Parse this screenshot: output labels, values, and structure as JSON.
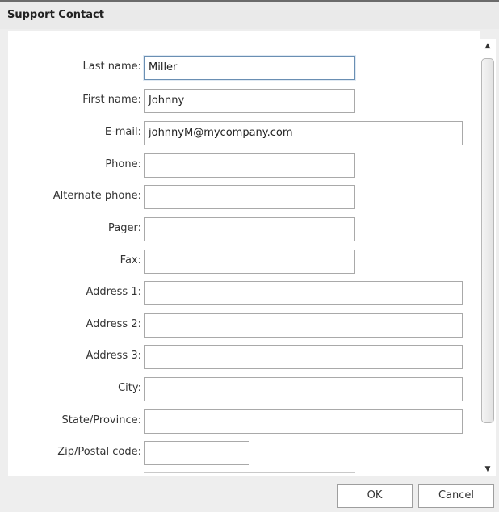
{
  "dialog": {
    "title": "Support Contact"
  },
  "form": {
    "fields": [
      {
        "label": "Last name:",
        "value": "Miller"
      },
      {
        "label": "First name:",
        "value": "Johnny"
      },
      {
        "label": "E-mail:",
        "value": "johnnyM@mycompany.com"
      },
      {
        "label": "Phone:",
        "value": ""
      },
      {
        "label": "Alternate phone:",
        "value": ""
      },
      {
        "label": "Pager:",
        "value": ""
      },
      {
        "label": "Fax:",
        "value": ""
      },
      {
        "label": "Address 1:",
        "value": ""
      },
      {
        "label": "Address 2:",
        "value": ""
      },
      {
        "label": "Address 3:",
        "value": ""
      },
      {
        "label": "City:",
        "value": ""
      },
      {
        "label": "State/Province:",
        "value": ""
      },
      {
        "label": "Zip/Postal code:",
        "value": ""
      }
    ]
  },
  "scrollbar": {
    "up_icon": "triangle-up",
    "down_icon": "triangle-down"
  },
  "buttons": {
    "ok_label": "OK",
    "cancel_label": "Cancel"
  }
}
